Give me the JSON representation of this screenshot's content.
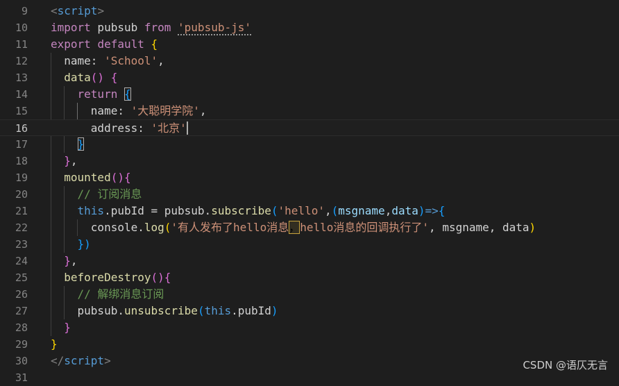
{
  "lines": [
    {
      "n": "9",
      "tokens": [
        [
          "tag",
          "<"
        ],
        [
          "tg",
          "script"
        ],
        [
          "tag",
          ">"
        ]
      ]
    },
    {
      "n": "10",
      "tokens": [
        [
          "k",
          "import"
        ],
        [
          "id",
          " pubsub "
        ],
        [
          "k",
          "from"
        ],
        [
          "id",
          " "
        ],
        [
          "s",
          "'pubsub-js'"
        ]
      ]
    },
    {
      "n": "11",
      "tokens": [
        [
          "k",
          "export"
        ],
        [
          "id",
          " "
        ],
        [
          "k",
          "default"
        ],
        [
          "id",
          " "
        ],
        [
          "b1",
          "{"
        ]
      ]
    },
    {
      "n": "12",
      "tokens": [
        [
          "id",
          "  name: "
        ],
        [
          "s",
          "'School'"
        ],
        [
          "id",
          ","
        ]
      ]
    },
    {
      "n": "13",
      "tokens": [
        [
          "id",
          "  "
        ],
        [
          "fn",
          "data"
        ],
        [
          "b2",
          "()"
        ],
        [
          "id",
          " "
        ],
        [
          "b2",
          "{"
        ]
      ]
    },
    {
      "n": "14",
      "tokens": [
        [
          "id",
          "    "
        ],
        [
          "k",
          "return"
        ],
        [
          "id",
          " "
        ],
        [
          "b3",
          "{"
        ]
      ]
    },
    {
      "n": "15",
      "tokens": [
        [
          "id",
          "      name: "
        ],
        [
          "s",
          "'大聪明学院'"
        ],
        [
          "id",
          ","
        ]
      ]
    },
    {
      "n": "16",
      "tokens": [
        [
          "id",
          "      address: "
        ],
        [
          "s",
          "'北京'"
        ]
      ],
      "current": true
    },
    {
      "n": "17",
      "tokens": [
        [
          "id",
          "    "
        ],
        [
          "b3",
          "}"
        ]
      ]
    },
    {
      "n": "18",
      "tokens": [
        [
          "id",
          "  "
        ],
        [
          "b2",
          "}"
        ],
        [
          "id",
          ","
        ]
      ]
    },
    {
      "n": "19",
      "tokens": [
        [
          "id",
          "  "
        ],
        [
          "fn",
          "mounted"
        ],
        [
          "b2",
          "(){"
        ]
      ]
    },
    {
      "n": "20",
      "tokens": [
        [
          "id",
          "    "
        ],
        [
          "c",
          "// 订阅消息"
        ]
      ]
    },
    {
      "n": "21",
      "tokens": [
        [
          "id",
          "    "
        ],
        [
          "kb",
          "this"
        ],
        [
          "id",
          ".pubId = pubsub."
        ],
        [
          "fn",
          "subscribe"
        ],
        [
          "b3",
          "("
        ],
        [
          "s",
          "'hello'"
        ],
        [
          "id",
          ","
        ],
        [
          "b3",
          "("
        ],
        [
          "v",
          "msgname"
        ],
        [
          "id",
          ","
        ],
        [
          "v",
          "data"
        ],
        [
          "b3",
          ")"
        ],
        [
          "kb",
          "=>"
        ],
        [
          "b3",
          "{"
        ]
      ]
    },
    {
      "n": "22",
      "tokens": [
        [
          "id",
          "      console."
        ],
        [
          "fn",
          "log"
        ],
        [
          "b1",
          "("
        ],
        [
          "s",
          "'有人发布了hello消息"
        ],
        [
          "hl",
          "，"
        ],
        [
          "s",
          "hello消息的回调执行了'"
        ],
        [
          "id",
          ", msgname, data"
        ],
        [
          "b1",
          ")"
        ]
      ]
    },
    {
      "n": "23",
      "tokens": [
        [
          "id",
          "    "
        ],
        [
          "b3",
          "})"
        ]
      ]
    },
    {
      "n": "24",
      "tokens": [
        [
          "id",
          "  "
        ],
        [
          "b2",
          "}"
        ],
        [
          "id",
          ","
        ]
      ]
    },
    {
      "n": "25",
      "tokens": [
        [
          "id",
          "  "
        ],
        [
          "fn",
          "beforeDestroy"
        ],
        [
          "b2",
          "(){"
        ]
      ]
    },
    {
      "n": "26",
      "tokens": [
        [
          "id",
          "    "
        ],
        [
          "c",
          "// 解绑消息订阅"
        ]
      ]
    },
    {
      "n": "27",
      "tokens": [
        [
          "id",
          "    pubsub."
        ],
        [
          "fn",
          "unsubscribe"
        ],
        [
          "b3",
          "("
        ],
        [
          "kb",
          "this"
        ],
        [
          "id",
          ".pubId"
        ],
        [
          "b3",
          ")"
        ]
      ]
    },
    {
      "n": "28",
      "tokens": [
        [
          "id",
          "  "
        ],
        [
          "b2",
          "}"
        ]
      ]
    },
    {
      "n": "29",
      "tokens": [
        [
          "b1",
          "}"
        ]
      ]
    },
    {
      "n": "30",
      "tokens": [
        [
          "tag",
          "</"
        ],
        [
          "tg",
          "script"
        ],
        [
          "tag",
          ">"
        ]
      ]
    },
    {
      "n": "31",
      "tokens": []
    }
  ],
  "watermark": "CSDN @语仄无言"
}
